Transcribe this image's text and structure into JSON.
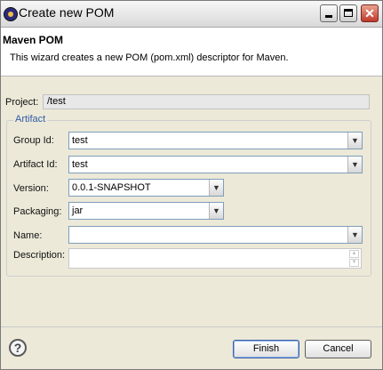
{
  "window": {
    "title": "Create new POM"
  },
  "banner": {
    "title": "Maven POM",
    "description": "This wizard creates a new POM (pom.xml) descriptor for Maven."
  },
  "project": {
    "label": "Project:",
    "value": "/test"
  },
  "artifact": {
    "legend": "Artifact",
    "group_id": {
      "label": "Group Id:",
      "value": "test"
    },
    "artifact_id": {
      "label": "Artifact Id:",
      "value": "test"
    },
    "version": {
      "label": "Version:",
      "value": "0.0.1-SNAPSHOT"
    },
    "packaging": {
      "label": "Packaging:",
      "value": "jar"
    },
    "name": {
      "label": "Name:",
      "value": ""
    },
    "description": {
      "label": "Description:",
      "value": ""
    }
  },
  "buttons": {
    "help": "?",
    "finish": "Finish",
    "cancel": "Cancel"
  },
  "icons": {
    "app": "eclipse-icon",
    "minimize": "minimize-icon",
    "maximize": "maximize-icon",
    "close": "close-icon",
    "dropdown": "chevron-down-icon",
    "help": "help-icon"
  },
  "colors": {
    "legend": "#2f5aa8",
    "close_button": "#c0392b"
  }
}
